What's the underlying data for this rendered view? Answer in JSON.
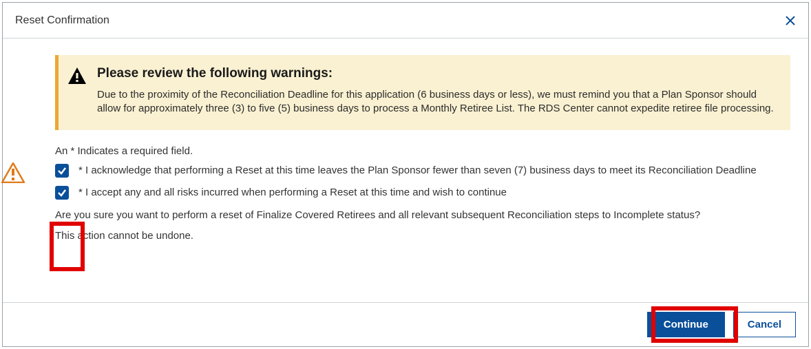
{
  "dialog": {
    "title": "Reset Confirmation"
  },
  "warning": {
    "heading": "Please review the following warnings:",
    "body": "Due to the proximity of the Reconciliation Deadline for this application (6 business days or less), we must remind you that a Plan Sponsor should allow for approximately three (3) to five (5) business days to process a Monthly Retiree List. The RDS Center cannot expedite retiree file processing."
  },
  "required_note": "An * Indicates a required field.",
  "checks": [
    {
      "checked": true,
      "label": "* I acknowledge that performing a Reset at this time leaves the Plan Sponsor fewer than seven (7) business days to meet its Reconciliation Deadline"
    },
    {
      "checked": true,
      "label": "* I accept any and all risks incurred when performing a Reset at this time and wish to continue"
    }
  ],
  "confirm_text": "Are you sure you want to perform a reset of Finalize Covered Retirees and all relevant subsequent Reconciliation steps to Incomplete status?",
  "undone_text": "This action cannot be undone.",
  "buttons": {
    "continue_label": "Continue",
    "cancel_label": "Cancel"
  }
}
